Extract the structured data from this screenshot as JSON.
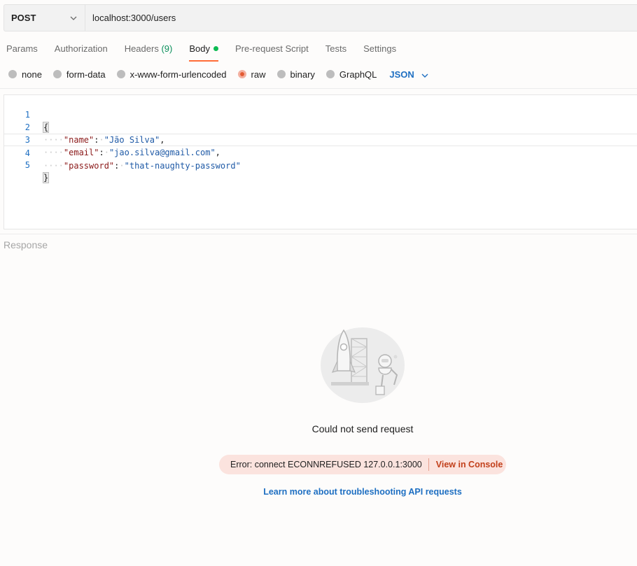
{
  "request": {
    "method": "POST",
    "url": "localhost:3000/users"
  },
  "tabs": [
    {
      "label": "Params"
    },
    {
      "label": "Authorization"
    },
    {
      "label": "Headers",
      "count": "(9)"
    },
    {
      "label": "Body"
    },
    {
      "label": "Pre-request Script"
    },
    {
      "label": "Tests"
    },
    {
      "label": "Settings"
    }
  ],
  "body_types": {
    "options": [
      "none",
      "form-data",
      "x-www-form-urlencoded",
      "raw",
      "binary",
      "GraphQL"
    ],
    "selected": "raw",
    "language": "JSON"
  },
  "editor": {
    "line_numbers": [
      "1",
      "2",
      "3",
      "4",
      "5"
    ],
    "open_brace": "{",
    "close_brace": "}",
    "fields": [
      {
        "key": "\"name\"",
        "value": "\"Jão Silva\"",
        "comma": ","
      },
      {
        "key": "\"email\"",
        "value": "\"jao.silva@gmail.com\"",
        "comma": ","
      },
      {
        "key": "\"password\"",
        "value": "\"that-naughty-password\"",
        "comma": ""
      }
    ]
  },
  "response": {
    "label": "Response",
    "message": "Could not send request",
    "error": "Error: connect ECONNREFUSED 127.0.0.1:3000",
    "view_console": "View in Console",
    "learn_more": "Learn more about troubleshooting API requests"
  },
  "colors": {
    "accent": "#ff6c37",
    "link": "#1e6fc2",
    "error_bg": "#fbe3de",
    "error_link": "#c2401b",
    "body_dot": "#0cbb52"
  }
}
